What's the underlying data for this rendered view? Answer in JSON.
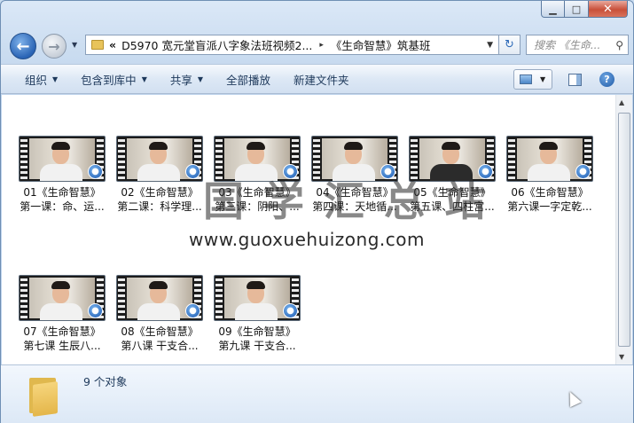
{
  "window": {
    "caption": {
      "minimize": "▁",
      "maximize": "□",
      "close": "✕"
    }
  },
  "nav": {
    "back_icon": "back-arrow",
    "forward_icon": "forward-arrow"
  },
  "address": {
    "overflow": "«",
    "crumbs": [
      "D5970 宽元堂盲派八字象法班视频2...",
      "《生命智慧》筑基班"
    ],
    "separator": "▸"
  },
  "search": {
    "placeholder": "搜索 《生命..."
  },
  "toolbar": {
    "organize": "组织",
    "include_library": "包含到库中",
    "share": "共享",
    "play_all": "全部播放",
    "new_folder": "新建文件夹"
  },
  "files": [
    {
      "name": "01《生命智慧》",
      "subtitle": "第一课：命、运..."
    },
    {
      "name": "02《生命智慧》",
      "subtitle": "第二课：科学理..."
    },
    {
      "name": "03《生命智慧》",
      "subtitle": "第三课：阴阳、..."
    },
    {
      "name": "04《生命智慧》",
      "subtitle": "第四课：天地循..."
    },
    {
      "name": "05《生命智慧》",
      "subtitle": "第五课、四柱宫..."
    },
    {
      "name": "06《生命智慧》",
      "subtitle": "第六课一字定乾..."
    },
    {
      "name": "07《生命智慧》",
      "subtitle": "第七课 生辰八..."
    },
    {
      "name": "08《生命智慧》",
      "subtitle": "第八课 干支合..."
    },
    {
      "name": "09《生命智慧》",
      "subtitle": "第九课 干支合..."
    }
  ],
  "watermark": {
    "cn": "国学汇总站",
    "url": "www.guoxuehuizong.com"
  },
  "details": {
    "count": "9 个对象"
  }
}
